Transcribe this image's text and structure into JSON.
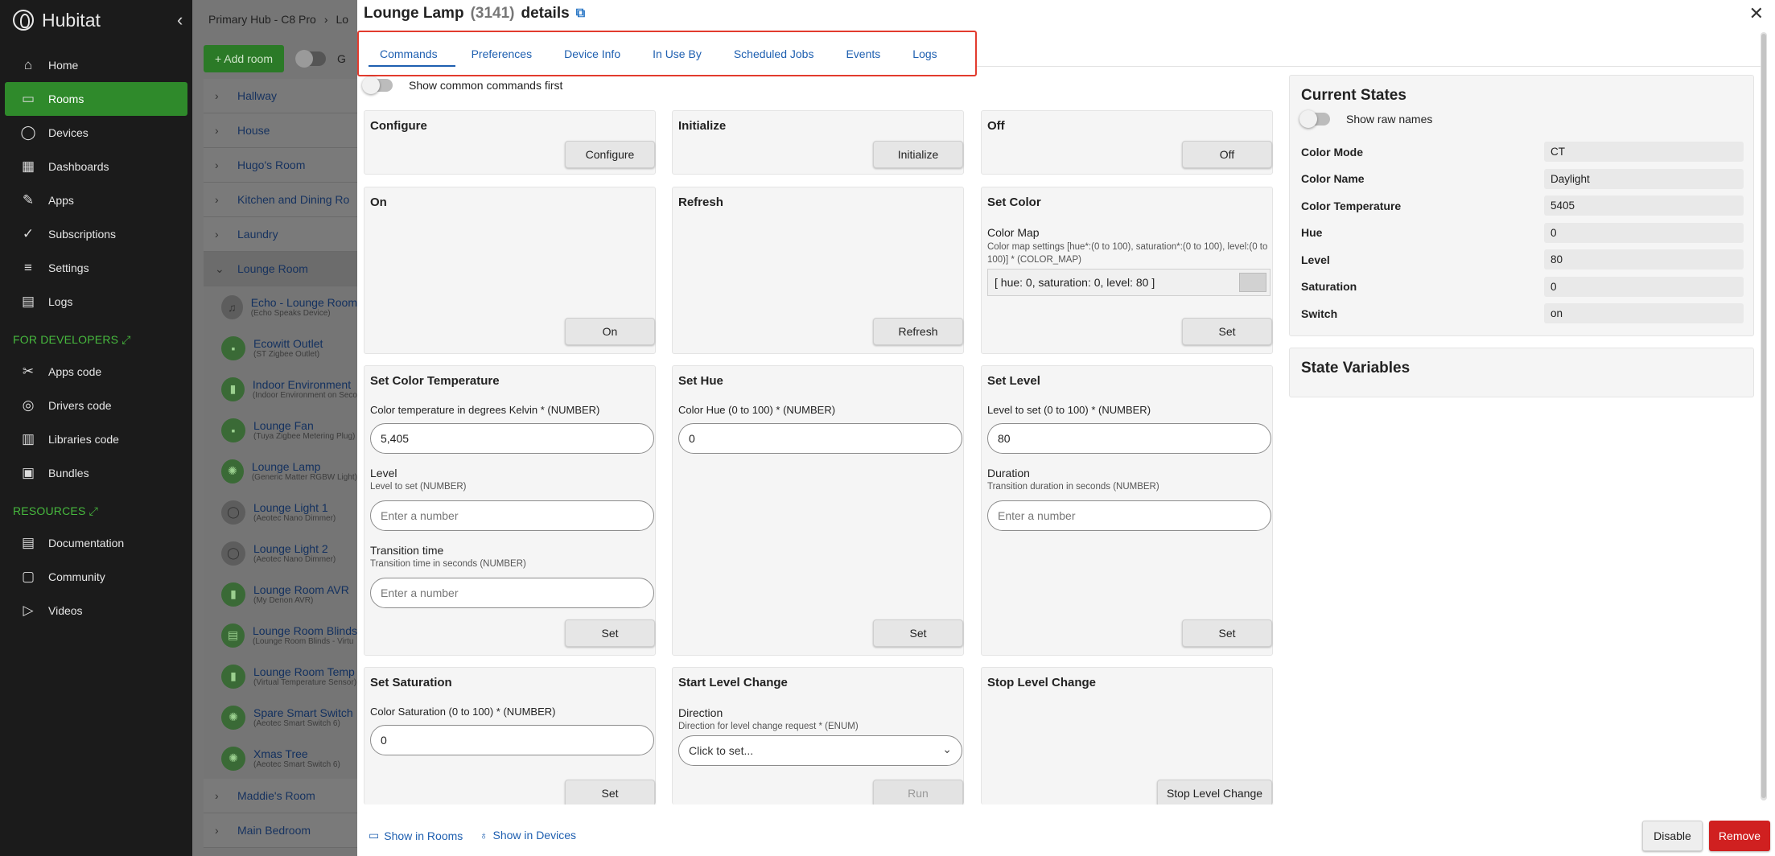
{
  "sidebar": {
    "brand": "Hubitat",
    "items": [
      {
        "label": "Home",
        "icon": "home-icon",
        "glyph": "⌂"
      },
      {
        "label": "Rooms",
        "icon": "bed-icon",
        "glyph": "▭"
      },
      {
        "label": "Devices",
        "icon": "bulb-icon",
        "glyph": "◯"
      },
      {
        "label": "Dashboards",
        "icon": "grid-icon",
        "glyph": "▦"
      },
      {
        "label": "Apps",
        "icon": "puzzle-icon",
        "glyph": "✎"
      },
      {
        "label": "Subscriptions",
        "icon": "check-circle-icon",
        "glyph": "✓"
      },
      {
        "label": "Settings",
        "icon": "sliders-icon",
        "glyph": "≡"
      },
      {
        "label": "Logs",
        "icon": "log-icon",
        "glyph": "▤"
      }
    ],
    "dev_section": "FOR DEVELOPERS",
    "dev_items": [
      {
        "label": "Apps code",
        "icon": "code-icon",
        "glyph": "✂"
      },
      {
        "label": "Drivers code",
        "icon": "driver-icon",
        "glyph": "◎"
      },
      {
        "label": "Libraries code",
        "icon": "library-icon",
        "glyph": "▥"
      },
      {
        "label": "Bundles",
        "icon": "bundle-icon",
        "glyph": "▣"
      }
    ],
    "res_section": "RESOURCES",
    "res_items": [
      {
        "label": "Documentation",
        "icon": "doc-icon",
        "glyph": "▤"
      },
      {
        "label": "Community",
        "icon": "chat-icon",
        "glyph": "▢"
      },
      {
        "label": "Videos",
        "icon": "video-icon",
        "glyph": "▷"
      }
    ]
  },
  "rooms": {
    "crumb": "Primary Hub - C8 Pro",
    "crumb2": "Lo",
    "add_room": "Add room",
    "toggle_label": "G",
    "top_rooms": [
      "Hallway",
      "House",
      "Hugo's Room",
      "Kitchen and Dining Ro",
      "Laundry"
    ],
    "open_room": "Lounge Room",
    "devices": [
      {
        "name": "Echo - Lounge Room",
        "type": "(Echo Speaks Device)",
        "glyph": "♫",
        "grey": true
      },
      {
        "name": "Ecowitt Outlet",
        "type": "(ST Zigbee Outlet)",
        "glyph": "▪",
        "grey": false
      },
      {
        "name": "Indoor Environment",
        "type": "(Indoor Environment on Seco",
        "glyph": "▮",
        "grey": false
      },
      {
        "name": "Lounge Fan",
        "type": "(Tuya Zigbee Metering Plug)",
        "glyph": "▪",
        "grey": false
      },
      {
        "name": "Lounge Lamp",
        "type": "(Generic Matter RGBW Light)",
        "glyph": "✺",
        "grey": false
      },
      {
        "name": "Lounge Light 1",
        "type": "(Aeotec Nano Dimmer)",
        "glyph": "◯",
        "grey": true
      },
      {
        "name": "Lounge Light 2",
        "type": "(Aeotec Nano Dimmer)",
        "glyph": "◯",
        "grey": true
      },
      {
        "name": "Lounge Room AVR",
        "type": "(My Denon AVR)",
        "glyph": "▮",
        "grey": false
      },
      {
        "name": "Lounge Room Blinds",
        "type": "(Lounge Room Blinds - Virtu",
        "glyph": "▤",
        "grey": false
      },
      {
        "name": "Lounge Room Temp",
        "type": "(Virtual Temperature Sensor)",
        "glyph": "▮",
        "grey": false
      },
      {
        "name": "Spare Smart Switch",
        "type": "(Aeotec Smart Switch 6)",
        "glyph": "✺",
        "grey": false
      },
      {
        "name": "Xmas Tree",
        "type": "(Aeotec Smart Switch 6)",
        "glyph": "✺",
        "grey": false
      }
    ],
    "bottom_rooms": [
      "Maddie's Room",
      "Main Bedroom"
    ]
  },
  "dialog": {
    "title_name": "Lounge Lamp",
    "title_id": "(3141)",
    "title_suffix": "details",
    "tabs": [
      "Commands",
      "Preferences",
      "Device Info",
      "In Use By",
      "Scheduled Jobs",
      "Events",
      "Logs"
    ],
    "common_first": "Show common commands first",
    "cards": {
      "configure": {
        "title": "Configure",
        "button": "Configure"
      },
      "initialize": {
        "title": "Initialize",
        "button": "Initialize"
      },
      "off": {
        "title": "Off",
        "button": "Off"
      },
      "on": {
        "title": "On",
        "button": "On"
      },
      "refresh": {
        "title": "Refresh",
        "button": "Refresh"
      },
      "set_color": {
        "title": "Set Color",
        "label": "Color Map",
        "desc": "Color map settings [hue*:(0 to 100), saturation*:(0 to 100), level:(0 to 100)] * (COLOR_MAP)",
        "value": "[ hue: 0, saturation: 0, level: 80 ]",
        "button": "Set"
      },
      "set_ct": {
        "title": "Set Color Temperature",
        "label": "Color temperature in degrees Kelvin * (NUMBER)",
        "value": "5,405",
        "level_label": "Level",
        "level_desc": "Level to set (NUMBER)",
        "level_ph": "Enter a number",
        "tt_label": "Transition time",
        "tt_desc": "Transition time in seconds (NUMBER)",
        "tt_ph": "Enter a number",
        "button": "Set"
      },
      "set_hue": {
        "title": "Set Hue",
        "label": "Color Hue (0 to 100) * (NUMBER)",
        "value": "0",
        "button": "Set"
      },
      "set_level": {
        "title": "Set Level",
        "label": "Level to set (0 to 100) * (NUMBER)",
        "value": "80",
        "dur_label": "Duration",
        "dur_desc": "Transition duration in seconds (NUMBER)",
        "dur_ph": "Enter a number",
        "button": "Set"
      },
      "set_sat": {
        "title": "Set Saturation",
        "label": "Color Saturation (0 to 100) * (NUMBER)",
        "value": "0",
        "button": "Set"
      },
      "start_level": {
        "title": "Start Level Change",
        "label": "Direction",
        "desc": "Direction for level change request * (ENUM)",
        "select": "Click to set...",
        "button": "Run"
      },
      "stop_level": {
        "title": "Stop Level Change",
        "button": "Stop Level Change"
      }
    },
    "states": {
      "title": "Current States",
      "raw_names": "Show raw names",
      "rows": [
        {
          "k": "Color Mode",
          "v": "CT"
        },
        {
          "k": "Color Name",
          "v": "Daylight"
        },
        {
          "k": "Color Temperature",
          "v": "5405"
        },
        {
          "k": "Hue",
          "v": "0"
        },
        {
          "k": "Level",
          "v": "80"
        },
        {
          "k": "Saturation",
          "v": "0"
        },
        {
          "k": "Switch",
          "v": "on"
        }
      ]
    },
    "state_vars": "State Variables",
    "footer": {
      "show_rooms": "Show in Rooms",
      "show_devices": "Show in Devices",
      "disable": "Disable",
      "remove": "Remove"
    }
  }
}
